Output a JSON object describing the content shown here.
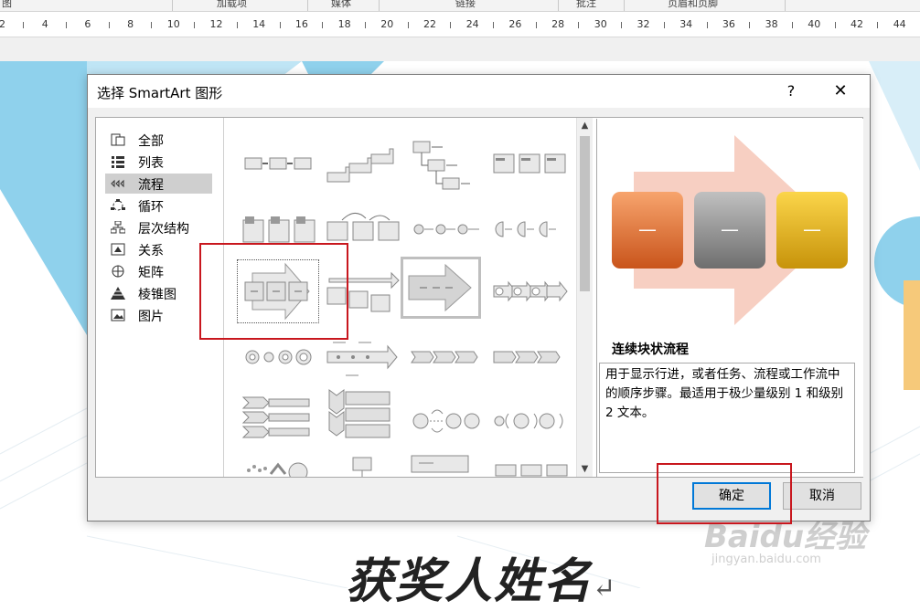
{
  "ribbon": {
    "tabs": [
      "图",
      "加载项",
      "媒体",
      "链接",
      "批注",
      "页眉和页脚"
    ]
  },
  "ruler": {
    "numbers": [
      "2",
      "4",
      "6",
      "8",
      "10",
      "12",
      "14",
      "16",
      "18",
      "20",
      "22",
      "24",
      "26",
      "28",
      "30",
      "32",
      "34",
      "36",
      "38",
      "40",
      "42",
      "44"
    ]
  },
  "document": {
    "heading": "获奖人姓名",
    "paragraph_mark": "↵"
  },
  "watermark": {
    "brand": "Baidu经验",
    "url": "jingyan.baidu.com"
  },
  "dialog": {
    "title": "选择 SmartArt 图形",
    "help_label": "?",
    "close_label": "✕",
    "categories": [
      {
        "label": "全部",
        "icon": "all-icon"
      },
      {
        "label": "列表",
        "icon": "list-icon"
      },
      {
        "label": "流程",
        "icon": "process-icon",
        "selected": true
      },
      {
        "label": "循环",
        "icon": "cycle-icon"
      },
      {
        "label": "层次结构",
        "icon": "hierarchy-icon"
      },
      {
        "label": "关系",
        "icon": "relationship-icon"
      },
      {
        "label": "矩阵",
        "icon": "matrix-icon"
      },
      {
        "label": "棱锥图",
        "icon": "pyramid-icon"
      },
      {
        "label": "图片",
        "icon": "picture-icon"
      }
    ],
    "preview": {
      "name": "连续块状流程",
      "description": "用于显示行进，或者任务、流程或工作流中的顺序步骤。最适用于极少量级别 1 和级别 2 文本。",
      "block_labels": [
        "—",
        "—",
        "—"
      ],
      "colors": {
        "block1": "#e8712c",
        "block2": "#8c8c8c",
        "block3": "#e8b511",
        "arrow": "#f7cfc2"
      }
    },
    "scroll": {
      "up": "▲",
      "down": "▼"
    },
    "buttons": {
      "ok": "确定",
      "cancel": "取消"
    },
    "highlight_color": "#c8171e"
  }
}
